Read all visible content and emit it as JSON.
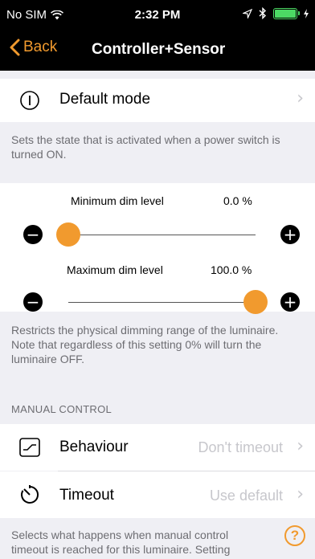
{
  "status_bar": {
    "carrier": "No SIM",
    "time": "2:32 PM"
  },
  "nav": {
    "back_label": "Back",
    "title": "Controller+Sensor"
  },
  "default_mode": {
    "label": "Default mode",
    "description": "Sets the state that is activated when a power switch is turned ON."
  },
  "dim": {
    "min_label": "Minimum dim level",
    "min_value": "0.0 %",
    "min_fraction": 0.0,
    "max_label": "Maximum dim level",
    "max_value": "100.0 %",
    "max_fraction": 1.0,
    "description": "Restricts the physical dimming range of the luminaire. Note that regardless of this setting 0% will turn the luminaire OFF."
  },
  "manual_control": {
    "header": "MANUAL CONTROL",
    "behaviour_label": "Behaviour",
    "behaviour_value": "Don't timeout",
    "timeout_label": "Timeout",
    "timeout_value": "Use default",
    "description": "Selects what happens when manual control timeout is reached for this luminaire. Setting"
  },
  "colors": {
    "accent": "#f19a2e",
    "background": "#efeff4",
    "battery": "#4cd964"
  }
}
